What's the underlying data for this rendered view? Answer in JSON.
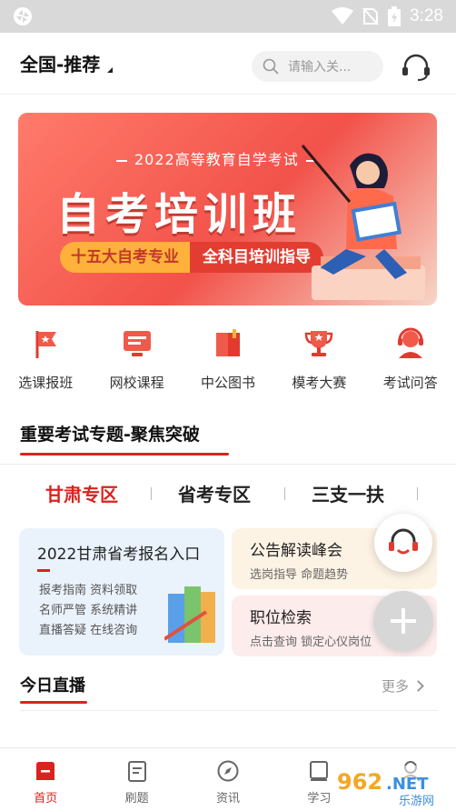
{
  "status_bar": {
    "time": "3:28"
  },
  "header": {
    "region": "全国-推荐",
    "search_placeholder": "请输入关..."
  },
  "banner": {
    "subtitle": "2022高等教育自学考试",
    "title": "自考培训班",
    "tag1": "十五大自考专业",
    "tag2": "全科目培训指导"
  },
  "quick_links": [
    {
      "label": "选课报班",
      "icon": "flag-icon"
    },
    {
      "label": "网校课程",
      "icon": "monitor-icon"
    },
    {
      "label": "中公图书",
      "icon": "book-icon"
    },
    {
      "label": "模考大赛",
      "icon": "trophy-icon"
    },
    {
      "label": "考试问答",
      "icon": "support-agent-icon"
    }
  ],
  "section": {
    "title": "重要考试专题-聚焦突破"
  },
  "zones": [
    "甘肃专区",
    "省考专区",
    "三支一扶"
  ],
  "cards": {
    "big": {
      "title": "2022甘肃省考报名入口",
      "lines": [
        "报考指南  资料领取",
        "名师严管  系统精讲",
        "直播答疑  在线咨询"
      ]
    },
    "small1": {
      "title": "公告解读峰会",
      "sub": "选岗指导 命题趋势"
    },
    "small2": {
      "title": "职位检索",
      "sub": "点击查询 锁定心仪岗位"
    }
  },
  "live": {
    "title": "今日直播",
    "more": "更多"
  },
  "bottom_nav": [
    {
      "label": "首页",
      "icon": "home-icon",
      "active": true
    },
    {
      "label": "刷题",
      "icon": "quiz-icon",
      "active": false
    },
    {
      "label": "资讯",
      "icon": "compass-icon",
      "active": false
    },
    {
      "label": "学习",
      "icon": "study-icon",
      "active": false
    },
    {
      "label": "",
      "icon": "profile-icon",
      "active": false
    }
  ],
  "watermark": {
    "text1": "962",
    "text2": ".NET",
    "text3": "乐游网"
  },
  "colors": {
    "accent": "#d9231e",
    "banner": "#f2524a"
  }
}
